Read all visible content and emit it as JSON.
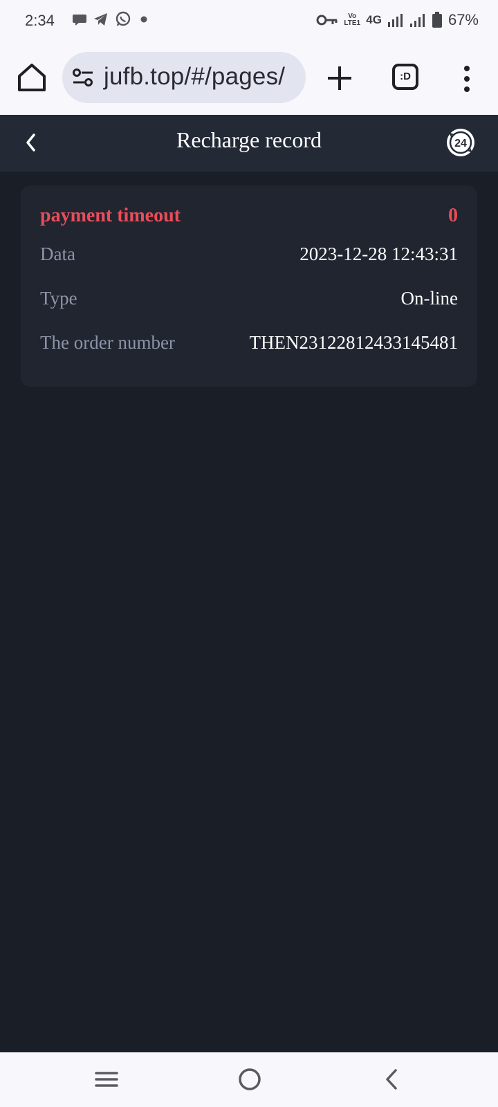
{
  "status_bar": {
    "time": "2:34",
    "network": "4G",
    "volte": "Vo LTE1",
    "battery": "67%",
    "left_icons": [
      "chat-bubble-icon",
      "telegram-icon",
      "whatsapp-icon",
      "dot-icon"
    ],
    "right_icons": [
      "vpn-key-icon",
      "volte-icon",
      "signal-icon",
      "signal-icon",
      "battery-icon"
    ]
  },
  "browser": {
    "url": "jufb.top/#/pages/",
    "tabs_label": ":D"
  },
  "header": {
    "title": "Recharge record"
  },
  "record": {
    "status": "payment timeout",
    "amount": "0",
    "fields": [
      {
        "label": "Data",
        "value": "2023-12-28 12:43:31"
      },
      {
        "label": "Type",
        "value": "On-line"
      },
      {
        "label": "The order number",
        "value": "THEN23122812433145481"
      }
    ]
  },
  "colors": {
    "background": "#191e27",
    "header": "#232a35",
    "card": "#202530",
    "accent_red": "#ea4d59",
    "label_gray": "#8e94a8"
  }
}
